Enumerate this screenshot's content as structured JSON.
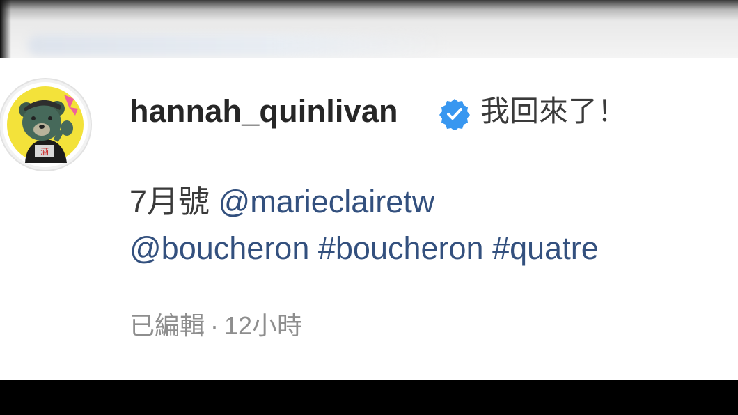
{
  "post_comment": {
    "username": "hannah_quinlivan",
    "verified_icon": "verified-badge-icon",
    "headline": "我回來了！",
    "issue_text": "7月號",
    "mention_1": "@marieclairetw",
    "mention_2": "@boucheron",
    "hashtag_1": "#boucheron",
    "hashtag_2": "#quatre",
    "edited_label": "已編輯",
    "separator": "·",
    "time_ago": "12小時"
  },
  "colors": {
    "username": "#262626",
    "body_text": "#3a3a3a",
    "link": "#33507e",
    "meta": "#8e8e8e",
    "verified": "#3897f0"
  }
}
